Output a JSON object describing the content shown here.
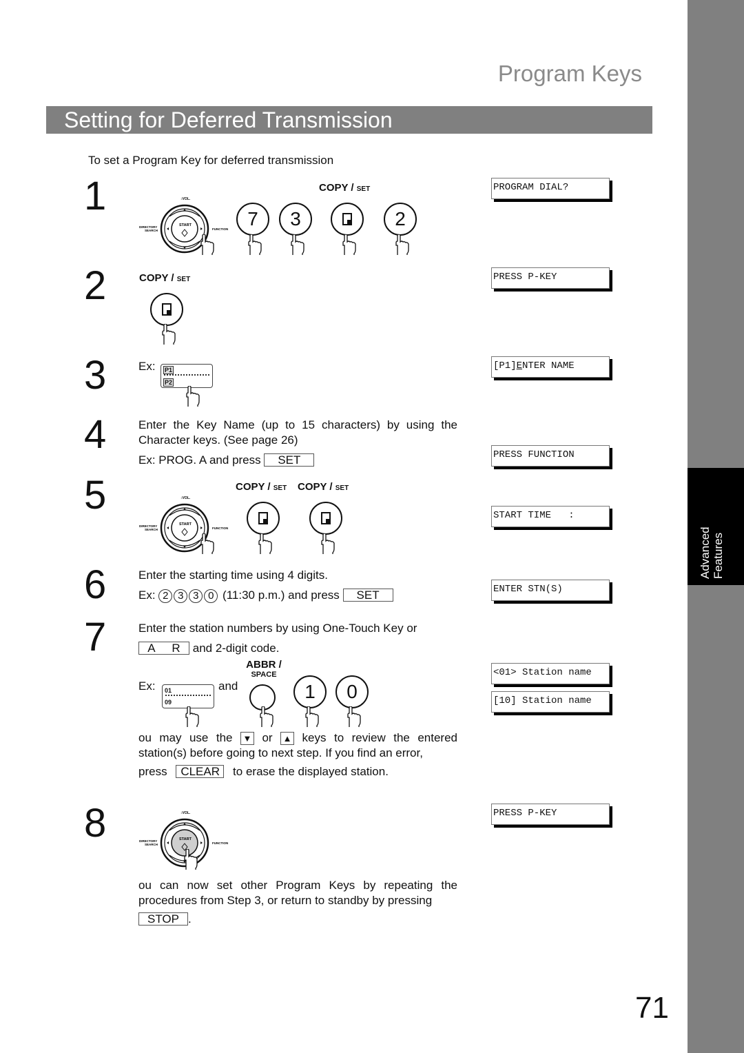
{
  "header": {
    "section_title": "Program Keys",
    "banner_title": "Setting for Deferred Transmission",
    "intro": "To set a Program Key for deferred transmission"
  },
  "sidebar": {
    "tab_label": "Advanced\nFeatures"
  },
  "keys": {
    "copy": "COPY / ",
    "set_small": "SET",
    "abbr": "ABBR /",
    "space": "SPACE",
    "vol": "↕VOL.",
    "start": "START",
    "directory": "DIRECTORY",
    "search": "SEARCH",
    "function": "FUNCTION",
    "set_key": "SET",
    "ar_key": "A R",
    "clear_key": "CLEAR",
    "stop_key": "STOP",
    "down_arrow": "▼",
    "up_arrow": "▲"
  },
  "steps": [
    {
      "number": "1",
      "buttons": [
        "7",
        "3",
        "copy-set",
        "2"
      ],
      "display": "PROGRAM DIAL?"
    },
    {
      "number": "2",
      "display": "PRESS P-KEY"
    },
    {
      "number": "3",
      "ex_label": "Ex:",
      "keys": [
        "P1",
        "P2"
      ],
      "display_prefix": "[P1]",
      "display_cursor": "E",
      "display_rest": "NTER NAME"
    },
    {
      "number": "4",
      "text": "Enter the Key Name (up to 15 characters) by using the Character keys.  (See page 26)",
      "example": "Ex:  PROG. A and press",
      "display": "PRESS FUNCTION"
    },
    {
      "number": "5",
      "display": "START TIME   :"
    },
    {
      "number": "6",
      "text": "Enter the starting time using 4 digits.",
      "ex_label": "Ex:",
      "digits": [
        "2",
        "3",
        "3",
        "0"
      ],
      "example_suffix": "(11:30 p.m.) and press",
      "display": "ENTER STN(S)"
    },
    {
      "number": "7",
      "text": "Enter the station numbers by using One-Touch Key or",
      "text2": "and 2-digit code.",
      "ex_label": "Ex:",
      "and": "and",
      "onetouch": [
        "01",
        "09"
      ],
      "buttons": [
        "1",
        "0"
      ],
      "display1": "<01> Station name",
      "display2": "[10] Station name",
      "note_a": " ou may use the",
      "note_or": "or",
      "note_b": "keys to review the entered station(s) before going to next step. If you find an error,",
      "note_press": "press",
      "note_c": "to erase the displayed station."
    },
    {
      "number": "8",
      "display": "PRESS P-KEY",
      "text": " ou can now set other Program Keys by repeating the procedures from Step 3, or return to standby by pressing",
      "period": "."
    }
  ],
  "footer": {
    "page_number": "71"
  }
}
